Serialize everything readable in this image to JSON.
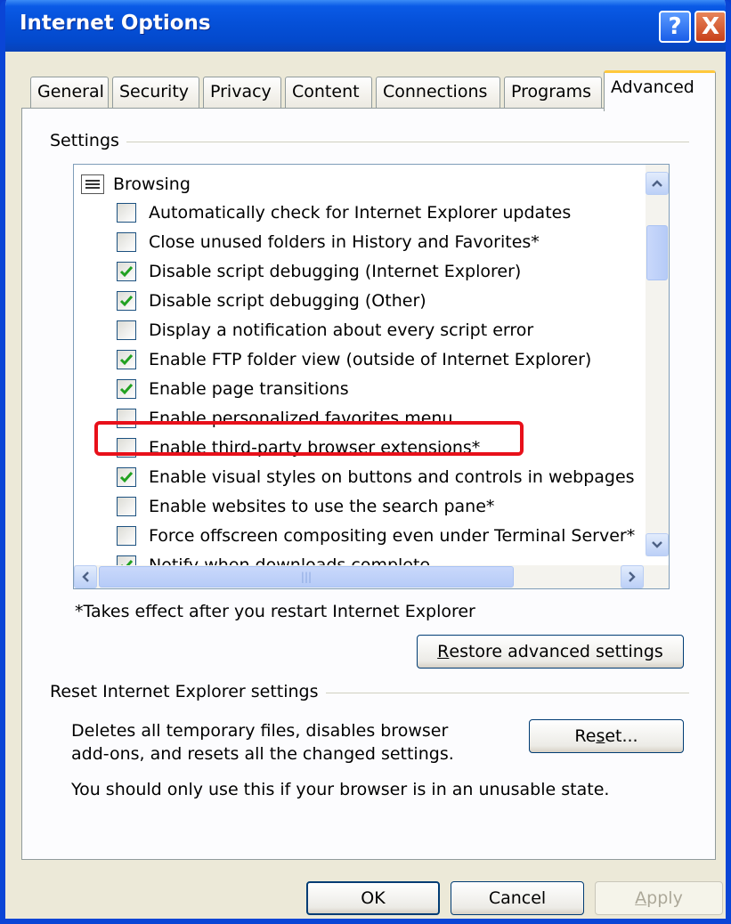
{
  "window": {
    "title": "Internet Options"
  },
  "titlebar": {
    "help_glyph": "?",
    "close_glyph": "X"
  },
  "tabs": [
    {
      "label": "General"
    },
    {
      "label": "Security"
    },
    {
      "label": "Privacy"
    },
    {
      "label": "Content"
    },
    {
      "label": "Connections"
    },
    {
      "label": "Programs"
    },
    {
      "label": "Advanced"
    }
  ],
  "settings": {
    "group_label": "Settings",
    "category": "Browsing",
    "items": [
      {
        "label": "Automatically check for Internet Explorer updates",
        "checked": false
      },
      {
        "label": "Close unused folders in History and Favorites*",
        "checked": false
      },
      {
        "label": "Disable script debugging (Internet Explorer)",
        "checked": true
      },
      {
        "label": "Disable script debugging (Other)",
        "checked": true
      },
      {
        "label": "Display a notification about every script error",
        "checked": false
      },
      {
        "label": "Enable FTP folder view (outside of Internet Explorer)",
        "checked": true
      },
      {
        "label": "Enable page transitions",
        "checked": true
      },
      {
        "label": "Enable personalized favorites menu",
        "checked": false
      },
      {
        "label": "Enable third-party browser extensions*",
        "checked": false
      },
      {
        "label": "Enable visual styles on buttons and controls in webpages",
        "checked": true
      },
      {
        "label": "Enable websites to use the search pane*",
        "checked": false
      },
      {
        "label": "Force offscreen compositing even under Terminal Server*",
        "checked": false
      },
      {
        "label": "Notify when downloads complete",
        "checked": true
      }
    ],
    "footnote": "*Takes effect after you restart Internet Explorer",
    "restore_button": {
      "label": "Restore advanced settings",
      "accel": "R",
      "rest": "estore advanced settings"
    }
  },
  "reset_group": {
    "label": "Reset Internet Explorer settings",
    "description_line1": "Deletes all temporary files, disables browser",
    "description_line2": "add-ons, and resets all the changed settings.",
    "warning": "You should only use this if your browser is in an unusable state.",
    "reset_button": {
      "pre": "Re",
      "accel": "s",
      "post": "et..."
    }
  },
  "footer": {
    "ok_label": "OK",
    "cancel_label": "Cancel",
    "apply_label": "Apply",
    "apply_accel": "A",
    "apply_rest": "pply"
  },
  "colors": {
    "accent": "#0a45d6",
    "highlight": "#e8101a",
    "check": "#21a121"
  }
}
